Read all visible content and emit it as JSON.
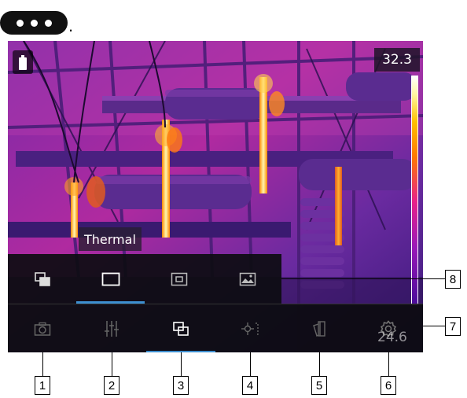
{
  "header": {
    "trailing_text": "."
  },
  "screen": {
    "max_temp": "32.3",
    "min_temp": "24.6",
    "mode_label": "Thermal"
  },
  "submenu": {
    "items": [
      {
        "name": "picture-in-picture-icon",
        "active": false
      },
      {
        "name": "thermal-rectangle-icon",
        "active": true
      },
      {
        "name": "framed-rectangle-icon",
        "active": false
      },
      {
        "name": "image-icon",
        "active": false
      }
    ]
  },
  "toolbar": {
    "items": [
      {
        "name": "camera-icon",
        "active": false
      },
      {
        "name": "sliders-icon",
        "active": false
      },
      {
        "name": "image-mode-icon",
        "active": true
      },
      {
        "name": "measurement-spot-icon",
        "active": false
      },
      {
        "name": "color-palette-icon",
        "active": false
      },
      {
        "name": "gear-icon",
        "active": false
      }
    ]
  },
  "callouts": {
    "c1": "1",
    "c2": "2",
    "c3": "3",
    "c4": "4",
    "c5": "5",
    "c6": "6",
    "c7": "7",
    "c8": "8"
  },
  "colors": {
    "accent": "#3d8fd0",
    "toolbar_bg": "#0c0c10",
    "scale_top": "#ffffff",
    "scale_bottom": "#4a0c9a"
  }
}
